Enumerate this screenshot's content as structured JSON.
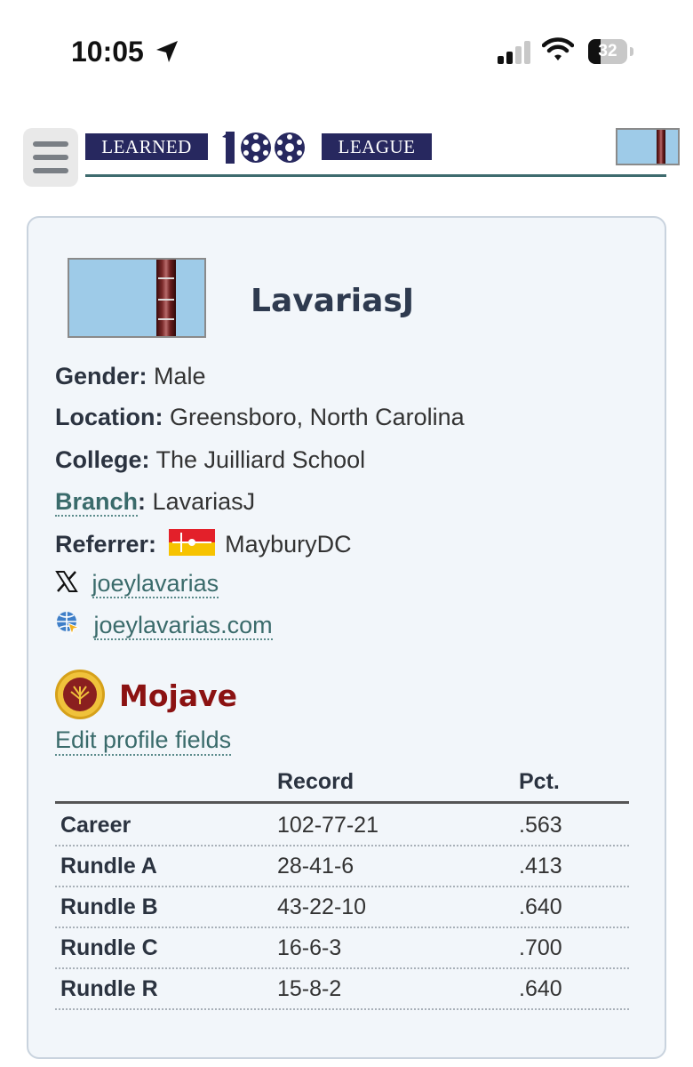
{
  "status_bar": {
    "time": "10:05",
    "battery": "32"
  },
  "header": {
    "banner_left": "LEARNED",
    "banner_center": "100",
    "banner_right": "LEAGUE"
  },
  "profile": {
    "username": "LavariasJ",
    "fields": {
      "gender_label": "Gender:",
      "gender": "Male",
      "location_label": "Location:",
      "location": "Greensboro, North Carolina",
      "college_label": "College:",
      "college": "The Juilliard School",
      "branch_label": "Branch",
      "branch_colon": ":",
      "branch": "LavariasJ",
      "referrer_label": "Referrer:",
      "referrer": "MayburyDC",
      "x_handle": "joeylavarias",
      "website": "joeylavarias.com"
    },
    "team": "Mojave",
    "edit_link": "Edit profile fields"
  },
  "stats": {
    "headers": [
      "",
      "Record",
      "Pct."
    ],
    "rows": [
      {
        "label": "Career",
        "record": "102-77-21",
        "pct": ".563"
      },
      {
        "label": "Rundle A",
        "record": "28-41-6",
        "pct": ".413"
      },
      {
        "label": "Rundle B",
        "record": "43-22-10",
        "pct": ".640"
      },
      {
        "label": "Rundle C",
        "record": "16-6-3",
        "pct": ".700"
      },
      {
        "label": "Rundle R",
        "record": "15-8-2",
        "pct": ".640"
      }
    ]
  }
}
